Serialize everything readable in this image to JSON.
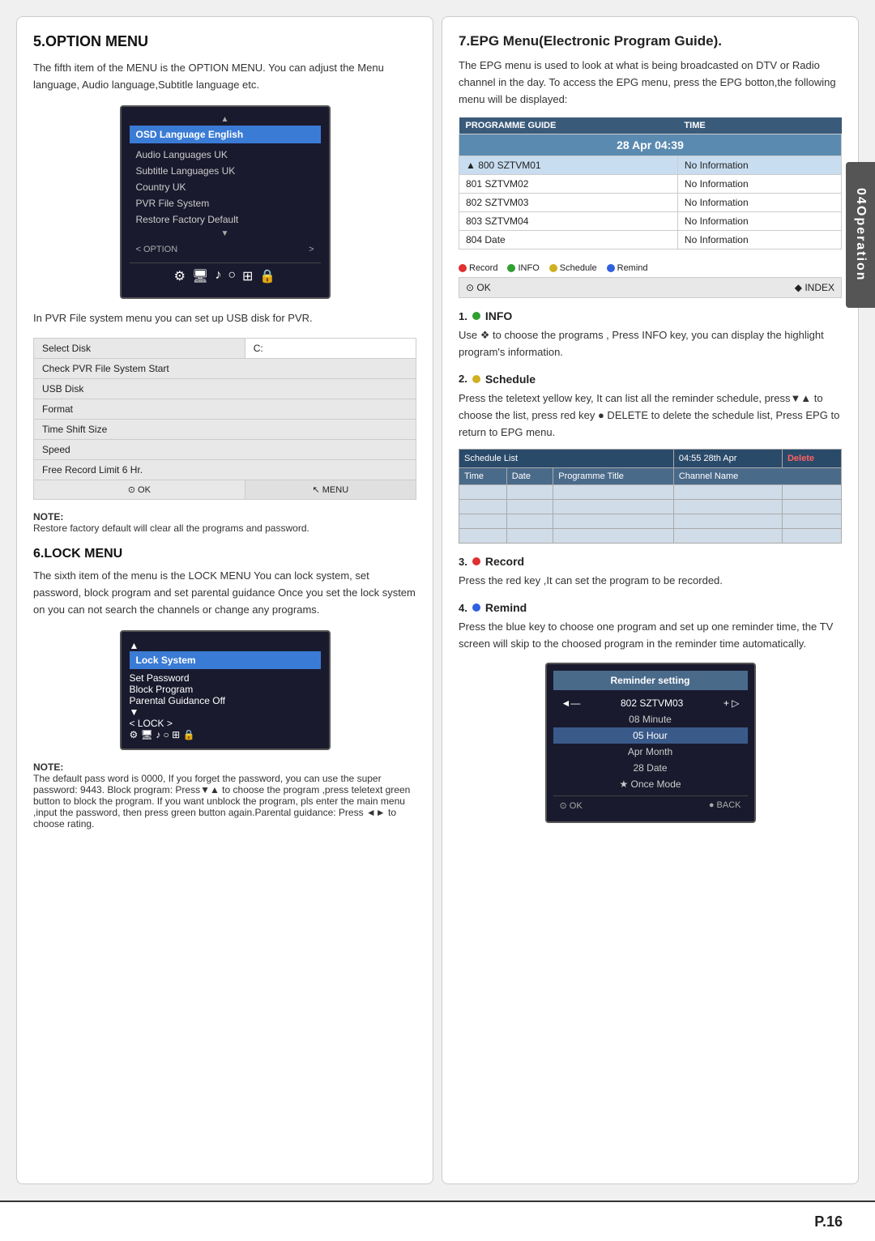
{
  "page": {
    "number": "P.16",
    "operation_tab": "Operation",
    "operation_number": "04"
  },
  "left": {
    "option_menu": {
      "title": "5.OPTION MENU",
      "body1": "The fifth item of the MENU is the OPTION MENU. You can adjust the Menu language, Audio language,Subtitle language etc.",
      "osd_menu": {
        "selected_item": "OSD Language English",
        "items": [
          "Audio Languages UK",
          "Subtitle Languages UK",
          "Country UK",
          "PVR File System",
          "Restore Factory Default"
        ],
        "nav_left": "< OPTION",
        "nav_right": ">",
        "icons": [
          "⚙",
          "🖥",
          "♪",
          "○",
          "⊞",
          "🔒"
        ]
      },
      "body2": "In PVR File system menu you can set up USB disk for PVR.",
      "pvr_table": {
        "rows": [
          {
            "label": "Select Disk",
            "value": "C:"
          },
          {
            "label": "Check PVR File System Start",
            "value": ""
          },
          {
            "label": "USB Disk",
            "value": ""
          },
          {
            "label": "Format",
            "value": ""
          },
          {
            "label": "Time Shift Size",
            "value": ""
          },
          {
            "label": "Speed",
            "value": ""
          },
          {
            "label": "Free Record Limit 6 Hr.",
            "value": ""
          }
        ],
        "footer_ok": "⊙ OK",
        "footer_menu": "↖ MENU"
      },
      "note_title": "NOTE:",
      "note_body": "Restore factory default will clear all the programs and password."
    },
    "lock_menu": {
      "title": "6.LOCK MENU",
      "body": "The sixth item of the menu is the LOCK MENU You can lock system, set password, block program and set parental  guidance Once you set the lock system on you can not search the channels or change  any programs.",
      "lock_box": {
        "selected_item": "Lock System",
        "items": [
          "Set Password",
          "Block Program",
          "Parental Guidance Off"
        ],
        "nav_left": "< LOCK",
        "nav_right": ">",
        "icons": [
          "⚙",
          "🖥",
          "♪",
          "○",
          "⊞",
          "🔒"
        ]
      },
      "note_title": "NOTE:",
      "note_body": "The default pass word is 0000, If you forget the password, you can use the super password: 9443. Block program: Press▼▲ to choose the program ,press teletext green button to block the program.  If you want unblock the program, pls enter the main menu ,input the password, then press green button again.Parental guidance: Press ◄► to choose rating."
    }
  },
  "right": {
    "epg_menu": {
      "title": "7.EPG Menu(Electronic Program Guide).",
      "body": "The EPG menu is used to look at what is being broadcasted on DTV or Radio channel in the day. To access the EPG menu, press the EPG botton,the following menu will be displayed:",
      "programme_guide_table": {
        "headers": [
          "PROGRAMME GUIDE",
          "TIME"
        ],
        "date": "28 Apr 04:39",
        "rows": [
          {
            "channel": "▲ 800 SZTVM01",
            "info": "No Information",
            "highlight": true
          },
          {
            "channel": "801 SZTVM02",
            "info": "No Information",
            "highlight": false
          },
          {
            "channel": "802 SZTVM03",
            "info": "No Information",
            "highlight": false
          },
          {
            "channel": "803 SZTVM04",
            "info": "No Information",
            "highlight": false
          },
          {
            "channel": "804 Date",
            "info": "No Information",
            "highlight": false
          }
        ],
        "legend": [
          {
            "color": "red",
            "label": "Record"
          },
          {
            "color": "green",
            "label": "INFO"
          },
          {
            "color": "yellow",
            "label": "Schedule"
          },
          {
            "color": "blue",
            "label": "Remind"
          }
        ],
        "footer_ok": "⊙ OK",
        "footer_index": "◆ INDEX"
      },
      "info_section": {
        "number": "1.",
        "color": "green",
        "title": "INFO",
        "body": "Use ❖ to choose the programs , Press INFO key, you can display the highlight  program's information."
      },
      "schedule_section": {
        "number": "2.",
        "color": "yellow",
        "title": "Schedule",
        "body": "Press the teletext yellow key, It can list all the reminder schedule, press▼▲  to choose the list,  press red key ● DELETE  to delete the schedule list, Press EPG  to return to EPG  menu.",
        "schedule_table": {
          "header": "Schedule List",
          "date": "04:55 28th Apr",
          "delete": "Delete",
          "columns": [
            "Time",
            "Date",
            "Programme Title",
            "Channel Name"
          ],
          "empty_rows": 4
        }
      },
      "record_section": {
        "number": "3.",
        "color": "red",
        "title": "Record",
        "body": "Press the  red key ,It can set the program to be recorded."
      },
      "remind_section": {
        "number": "4.",
        "color": "blue",
        "title": "Remind",
        "body": "Press the  blue key to choose one program and set up one reminder time, the TV screen will skip to the choosed program in the reminder time automatically.",
        "reminder_box": {
          "title": "Reminder setting",
          "channel": "802 SZTVM03",
          "nav_left": "◄—",
          "nav_right": "+ ▷",
          "rows": [
            "08 Minute",
            "05 Hour",
            "Apr Month",
            "28 Date",
            "★  Once Mode"
          ],
          "highlight_row": "05 Hour",
          "footer_ok": "⊙ OK",
          "footer_back": "● BACK"
        }
      }
    }
  }
}
